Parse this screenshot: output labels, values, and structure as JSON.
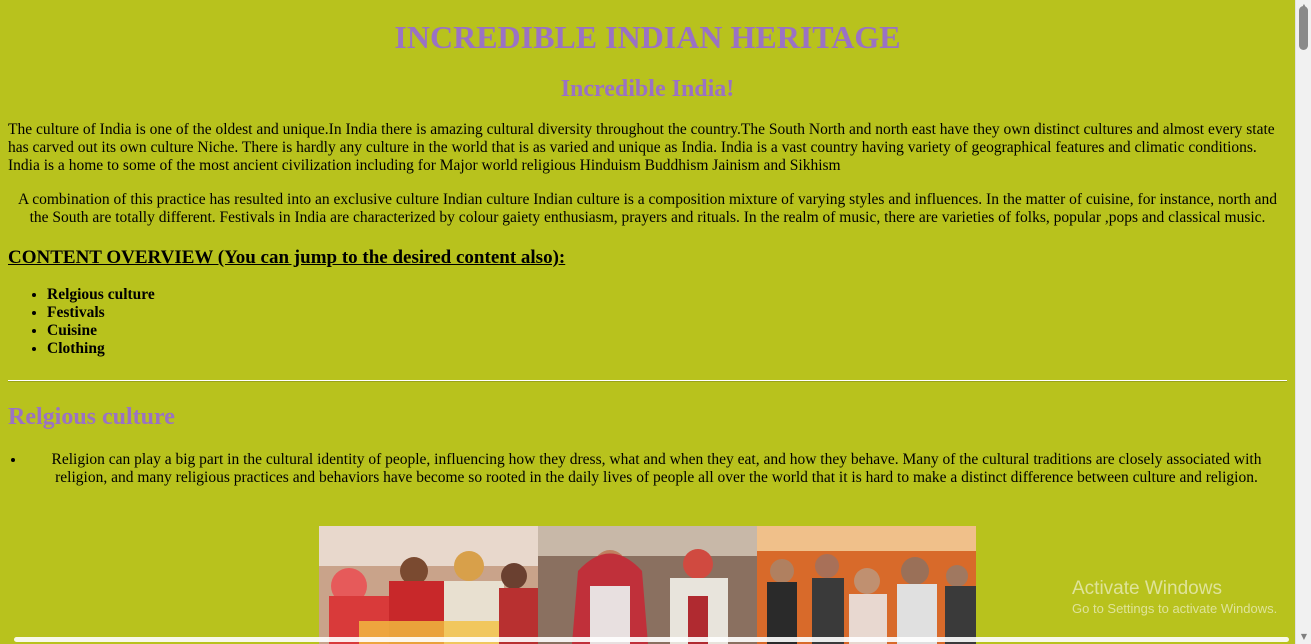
{
  "page": {
    "title": "INCREDIBLE INDIAN HERITAGE",
    "subtitle": "Incredible India!",
    "intro_paragraph": "The culture of India is one of the oldest and unique.In India there is amazing cultural diversity throughout the country.The South North and north east have they own distinct cultures and almost every state has carved out its own culture Niche. There is hardly any culture in the world that is as varied and unique as India. India is a vast country having variety of geographical features and climatic conditions. India is a home to some of the most ancient civilization including for Major world religious Hinduism Buddhism Jainism and Sikhism",
    "second_paragraph": "A combination of this practice has resulted into an exclusive culture Indian culture Indian culture is a composition mixture of varying styles and influences. In the matter of cuisine, for instance, north and the South are totally different. Festivals in India are characterized by colour gaiety enthusiasm, prayers and rituals. In the realm of music, there are varieties of folks, popular ,pops and classical music.",
    "overview_heading": "CONTENT OVERVIEW (You can jump to the desired content also):",
    "toc": [
      "Relgious culture",
      "Festivals",
      "Cuisine",
      "Clothing"
    ],
    "religion_heading": "Relgious culture",
    "religion_text": "Religion can play a big part in the cultural identity of people, influencing how they dress, what and when they eat, and how they behave. Many of the cultural traditions are closely associated with religion, and many religious practices and behaviors have become so rooted in the daily lives of people all over the world that it is hard to make a distinct difference between culture and religion."
  },
  "overlay": {
    "activate_title": "Activate Windows",
    "activate_subtitle": "Go to Settings to activate Windows."
  },
  "colors": {
    "background": "#b8c21d",
    "heading": "#9a72c4"
  }
}
